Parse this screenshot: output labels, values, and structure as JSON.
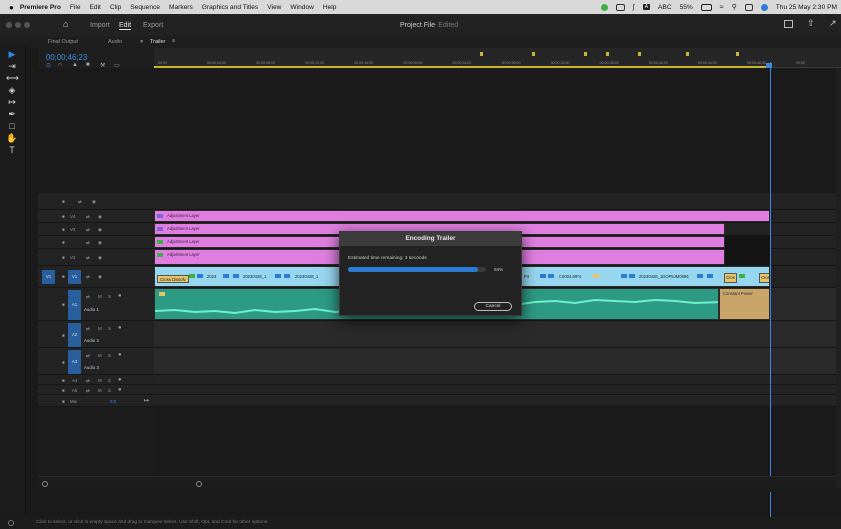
{
  "menubar": {
    "apple_icon": "apple-icon",
    "app_name": "Premiere Pro",
    "items": [
      "File",
      "Edit",
      "Clip",
      "Sequence",
      "Markers",
      "Graphics and Titles",
      "View",
      "Window",
      "Help"
    ],
    "keyboard_label": "ABC",
    "battery": "55%",
    "datetime": "Thu 25 May  2:30 PM"
  },
  "titlebar": {
    "workspaces": [
      "Import",
      "Edit",
      "Export"
    ],
    "active_workspace": "Edit",
    "project_title": "Project File",
    "project_state": "- Edited"
  },
  "panels": {
    "tabs": [
      "Final Output",
      "Audio",
      "Trailer"
    ],
    "active_tab": "Trailer",
    "timecode": "00;00;46;23"
  },
  "ruler": {
    "ticks": [
      "00;00",
      "00;00;04;00",
      "00;00;08;00",
      "00;00;12;00",
      "00;00;16;00",
      "00;00;20;00",
      "00;00;24;00",
      "00;00;28;00",
      "00;00;32;00",
      "00;00;36;00",
      "00;00;40;00",
      "00;00;44;00",
      "00;00;48;00",
      "00;00"
    ]
  },
  "tracks": {
    "v4": "V4",
    "v3": "V3",
    "v2": "V2",
    "v1": "V1",
    "v1_source": "V1",
    "a1": "A1",
    "a2": "A2",
    "a3": "A3",
    "a4": "A4",
    "a5": "A5",
    "audio1_name": "Audio 1",
    "audio2_name": "Audio 2",
    "audio3_name": "Audio 3",
    "mix_label": "Mix",
    "mix_value": "0.0",
    "m": "M",
    "s": "S"
  },
  "clips": {
    "adjustment": "Adjustment Layer",
    "cross_dissolve": "Cross Dissolv",
    "v1_labels": [
      "2023",
      "20230428_1",
      "20230428_1",
      "C0004.MP4"
    ],
    "v1_tail1": "20230428_1DOP5JM0696",
    "v1_tail2": "Cros",
    "v1_tail3": "Cros",
    "fragment": "P4",
    "constant_power": "Constant Power"
  },
  "dialog": {
    "title": "Encoding Trailer",
    "message": "Estimated time remaining: 3 seconds",
    "progress": 0.94,
    "percent_label": "94%",
    "cancel_label": "Cancel"
  },
  "statusbar": {
    "hint": "Click to select, or click in empty space and drag to marquee select. Use Shift, Opt, and Cmd for other options."
  },
  "colors": {
    "accent": "#2c7bd6",
    "adjustment_layer": "#df7ee0",
    "video_clip": "#96d6ee",
    "audio_clip": "#2d9a84"
  }
}
